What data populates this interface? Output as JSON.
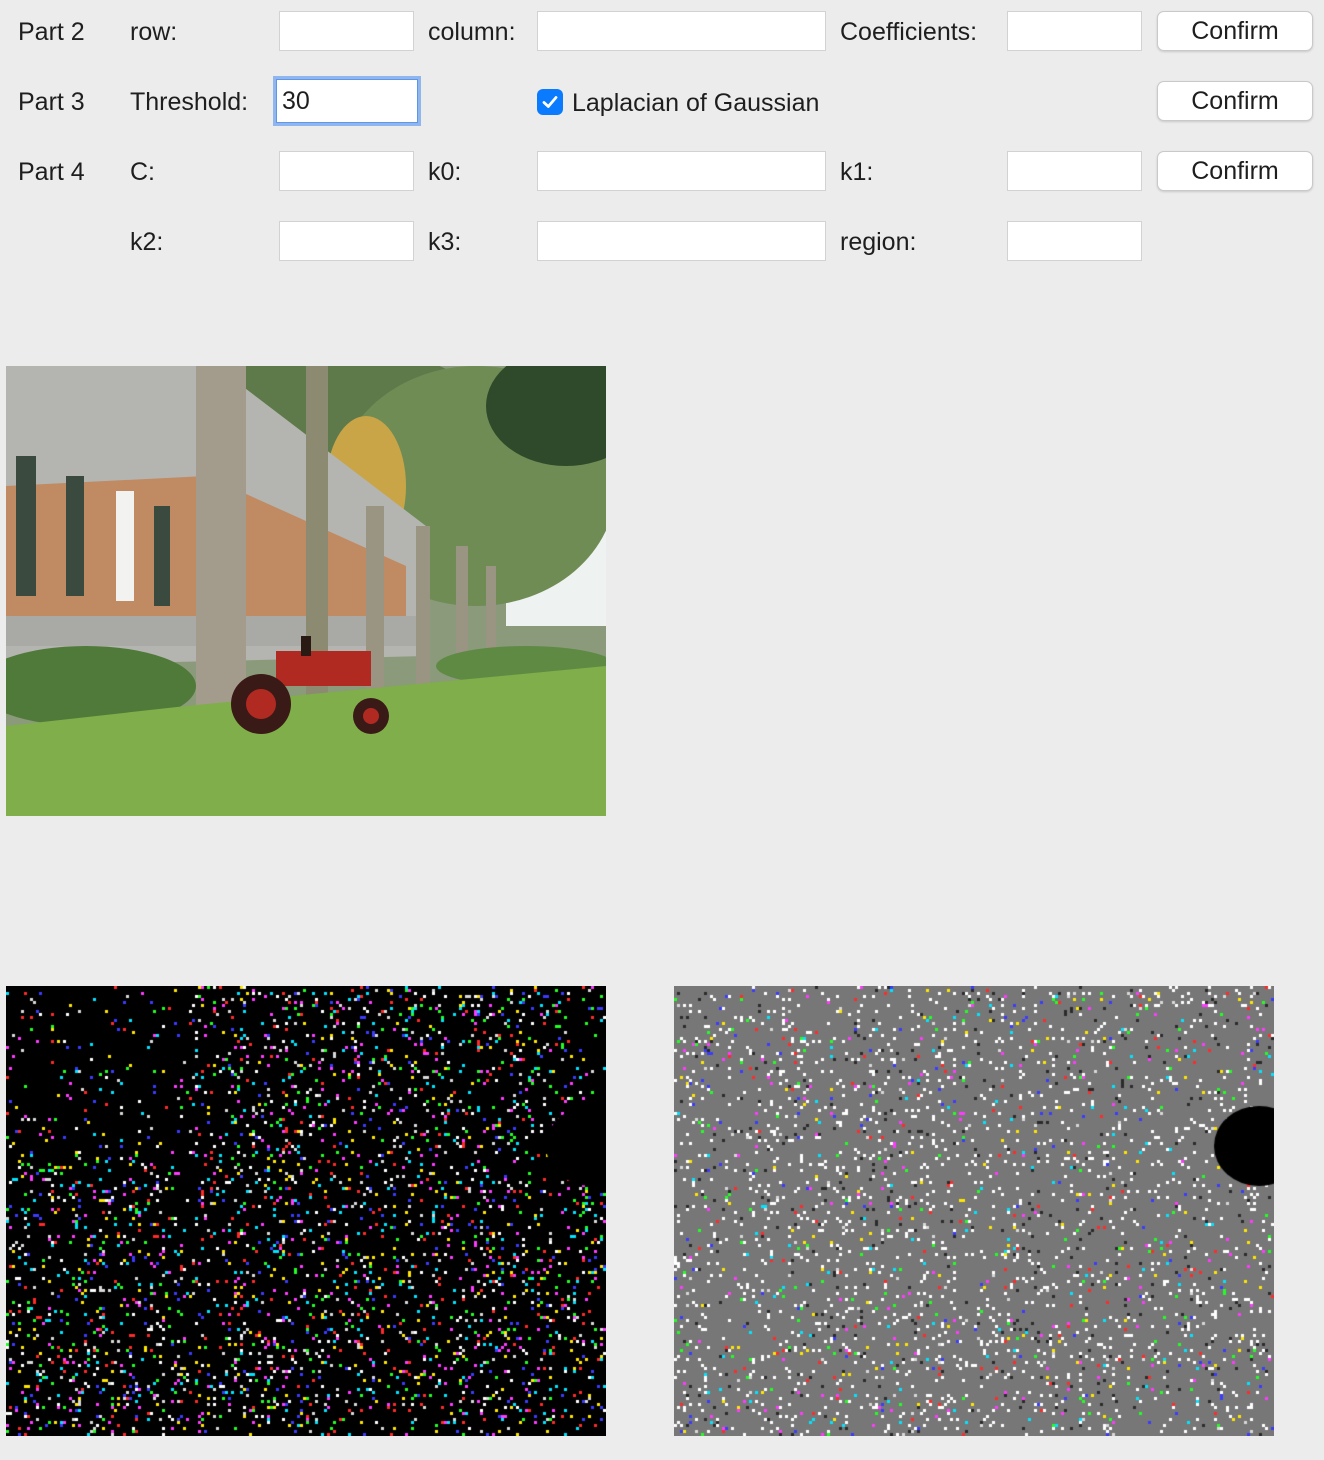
{
  "part2": {
    "label": "Part 2",
    "row_label": "row:",
    "row_value": "",
    "column_label": "column:",
    "column_value": "",
    "coef_label": "Coefficients:",
    "coef_value": "",
    "confirm": "Confirm"
  },
  "part3": {
    "label": "Part 3",
    "threshold_label": "Threshold:",
    "threshold_value": "30",
    "log_label": "Laplacian of Gaussian",
    "log_checked": true,
    "confirm": "Confirm"
  },
  "part4": {
    "label": "Part 4",
    "c_label": "C:",
    "c_value": "",
    "k0_label": "k0:",
    "k0_value": "",
    "k1_label": "k1:",
    "k1_value": "",
    "k2_label": "k2:",
    "k2_value": "",
    "k3_label": "k3:",
    "k3_value": "",
    "region_label": "region:",
    "region_value": "",
    "confirm": "Confirm"
  },
  "images": {
    "original": "original-photo",
    "result_left": "edge-result-dark",
    "result_right": "edge-result-noise"
  },
  "colors": {
    "accent": "#0a7aff",
    "background": "#ececec"
  }
}
